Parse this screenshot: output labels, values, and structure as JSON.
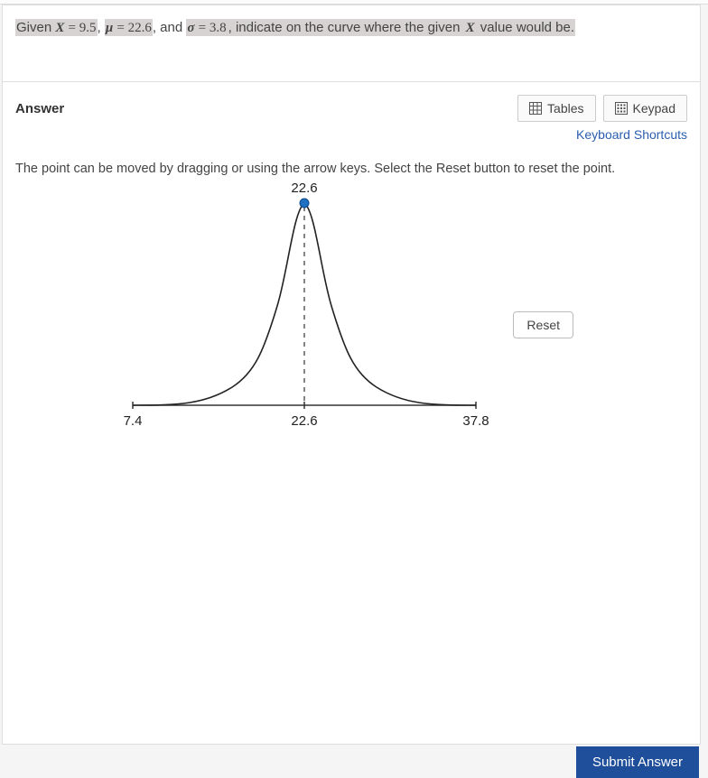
{
  "question": {
    "prefix": "Given ",
    "x_eq": "X = 9.5",
    "comma1": ", ",
    "mu_eq": "μ = 22.6",
    "comma2": ", and ",
    "sigma_eq": "σ = 3.8",
    "tail": ", indicate on the curve where the given ",
    "xvar": "X",
    "tail2": " value would be."
  },
  "answer": {
    "label": "Answer",
    "tables_btn": "Tables",
    "keypad_btn": "Keypad",
    "shortcuts_link": "Keyboard Shortcuts",
    "instruction": "The point can be moved by dragging or using the arrow keys. Select the Reset button to reset the point.",
    "reset_btn": "Reset"
  },
  "chart_data": {
    "type": "line",
    "title": "",
    "xlabel": "",
    "ylabel": "",
    "xlim": [
      7.4,
      37.8
    ],
    "mu": 22.6,
    "sigma": 3.8,
    "x_ticks": [
      7.4,
      22.6,
      37.8
    ],
    "marker_value": 22.6,
    "marker_label": "22.6"
  },
  "submit_btn": "Submit Answer"
}
